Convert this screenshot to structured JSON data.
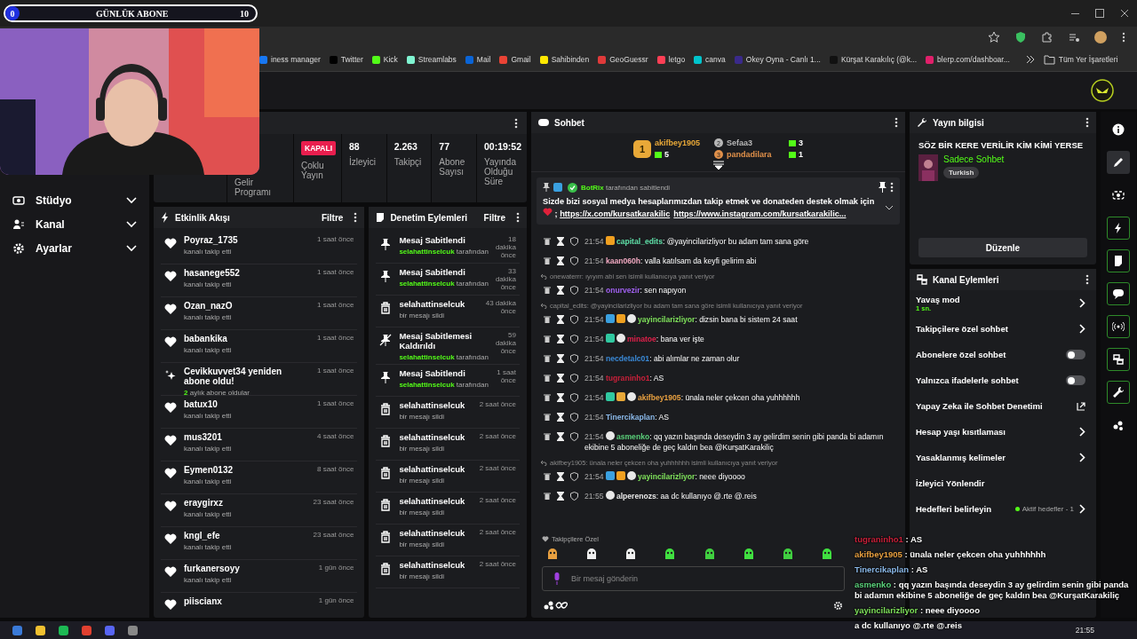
{
  "goal_overlay": {
    "current": "0",
    "label": "GÜNLÜK ABONE",
    "target": "10"
  },
  "bookmarks": [
    {
      "label": "iness manager",
      "color": "#1877f2"
    },
    {
      "label": "Twitter",
      "color": "#000000"
    },
    {
      "label": "Kick",
      "color": "#53fc18"
    },
    {
      "label": "Streamlabs",
      "color": "#80f5d2"
    },
    {
      "label": "Mail",
      "color": "#0a64d6"
    },
    {
      "label": "Gmail",
      "color": "#ea4335"
    },
    {
      "label": "Sahibinden",
      "color": "#ffe800"
    },
    {
      "label": "GeoGuessr",
      "color": "#e03a3a"
    },
    {
      "label": "letgo",
      "color": "#ff3f55"
    },
    {
      "label": "canva",
      "color": "#00c4cc"
    },
    {
      "label": "Okey Oyna - Canlı 1...",
      "color": "#3a2a8a"
    },
    {
      "label": "Kürşat Karakılıç (@k...",
      "color": "#111111"
    },
    {
      "label": "blerp.com/dashboar...",
      "color": "#e0206a"
    }
  ],
  "bookmarks_all": "Tüm Yer İşaretleri",
  "sidebar": {
    "items": [
      {
        "kind": "studio",
        "label": "Stüdyo"
      },
      {
        "kind": "channel",
        "label": "Kanal"
      },
      {
        "kind": "settings",
        "label": "Ayarlar"
      }
    ]
  },
  "stats": [
    {
      "label": "Gelir Programı"
    },
    {
      "badge": "KAPALI",
      "label": "Çoklu Yayın"
    },
    {
      "value": "88",
      "label": "İzleyici"
    },
    {
      "value": "2.263",
      "label": "Takipçi"
    },
    {
      "value": "77",
      "label": "Abone Sayısı"
    },
    {
      "value": "00:19:52",
      "label": "Yayında Olduğu Süre"
    }
  ],
  "activity": {
    "title": "Etkinlik Akışı",
    "filter": "Filtre",
    "items": [
      {
        "kind": "follow",
        "name": "Poyraz_1735",
        "detail": "kanalı takip etti",
        "time": "1 saat önce"
      },
      {
        "kind": "follow",
        "name": "hasanege552",
        "detail": "kanalı takip etti",
        "time": "1 saat önce"
      },
      {
        "kind": "follow",
        "name": "Ozan_nazO",
        "detail": "kanalı takip etti",
        "time": "1 saat önce"
      },
      {
        "kind": "follow",
        "name": "babankika",
        "detail": "kanalı takip etti",
        "time": "1 saat önce"
      },
      {
        "kind": "resub",
        "name": "Cevikkuvvet34 yeniden abone oldu!",
        "months": "2",
        "detail": "aylık abone oldular",
        "time": "1 saat önce"
      },
      {
        "kind": "follow",
        "name": "batux10",
        "detail": "kanalı takip etti",
        "time": "1 saat önce"
      },
      {
        "kind": "follow",
        "name": "mus3201",
        "detail": "kanalı takip etti",
        "time": "4 saat önce"
      },
      {
        "kind": "follow",
        "name": "Eymen0132",
        "detail": "kanalı takip etti",
        "time": "8 saat önce"
      },
      {
        "kind": "follow",
        "name": "eraygirxz",
        "detail": "kanalı takip etti",
        "time": "23 saat önce"
      },
      {
        "kind": "follow",
        "name": "kngl_efe",
        "detail": "kanalı takip etti",
        "time": "23 saat önce"
      },
      {
        "kind": "follow",
        "name": "furkanersoyy",
        "detail": "kanalı takip etti",
        "time": "1 gün önce"
      },
      {
        "kind": "follow",
        "name": "piiscianx",
        "time": "1 gün önce"
      }
    ]
  },
  "moderation": {
    "title": "Denetim Eylemleri",
    "filter": "Filtre",
    "items": [
      {
        "kind": "pin",
        "title": "Mesaj Sabitlendi",
        "user": "selahattinselcuk",
        "suffix": "tarafından",
        "time": "18 dakika önce"
      },
      {
        "kind": "pin",
        "title": "Mesaj Sabitlendi",
        "user": "selahattinselcuk",
        "suffix": "tarafından",
        "time": "33 dakika önce"
      },
      {
        "kind": "delete",
        "title": "selahattinselcuk",
        "detail": "bir mesajı sildi",
        "time": "43 dakika önce"
      },
      {
        "kind": "unpin",
        "title": "Mesaj Sabitlemesi Kaldırıldı",
        "user": "selahattinselcuk",
        "suffix": "tarafından",
        "time": "59 dakika önce"
      },
      {
        "kind": "pin",
        "title": "Mesaj Sabitlendi",
        "user": "selahattinselcuk",
        "suffix": "tarafından",
        "time": "1 saat önce"
      },
      {
        "kind": "delete",
        "title": "selahattinselcuk",
        "detail": "bir mesajı sildi",
        "time": "2 saat önce"
      },
      {
        "kind": "delete",
        "title": "selahattinselcuk",
        "detail": "bir mesajı sildi",
        "time": "2 saat önce"
      },
      {
        "kind": "delete",
        "title": "selahattinselcuk",
        "detail": "bir mesajı sildi",
        "time": "2 saat önce"
      },
      {
        "kind": "delete",
        "title": "selahattinselcuk",
        "detail": "bir mesajı sildi",
        "time": "2 saat önce"
      },
      {
        "kind": "delete",
        "title": "selahattinselcuk",
        "detail": "bir mesajı sildi",
        "time": "2 saat önce"
      },
      {
        "kind": "delete",
        "title": "selahattinselcuk",
        "detail": "bir mesajı sildi",
        "time": "2 saat önce"
      }
    ]
  },
  "chat": {
    "title": "Sohbet",
    "gifters": [
      {
        "rank": "1",
        "name": "akifbey1905",
        "count": "5",
        "color": "#e8a838"
      },
      {
        "rank": "2",
        "name": "Sefaa3",
        "count": "3",
        "color": "#b8b8b8"
      },
      {
        "rank": "3",
        "name": "pandadilara",
        "count": "1",
        "color": "#e0904a"
      }
    ],
    "pinned": {
      "by": "BotRix",
      "note": "tarafından sabitlendi",
      "text": "Sizde bizi sosyal medya hesaplarımızdan takip etmek ve donateden destek olmak için",
      "separator": ";",
      "links": [
        "https://x.com/kursatkarakilic",
        "https://www.instagram.com/kursatkarakilic..."
      ]
    },
    "messages": [
      {
        "kind": "message",
        "time": "21:54",
        "badges": [
          {
            "kind": "crown"
          }
        ],
        "user": "capital_edits",
        "color": "#5fe0a8",
        "text": ": @yayincilarizliyor bu adam tam sana göre"
      },
      {
        "kind": "message",
        "time": "21:54",
        "user": "kaan060h",
        "color": "#f0a8c0",
        "text": ": valla katılsam da keyfi gelirim abi"
      },
      {
        "kind": "reply",
        "text": "onewaterrr: ıyıyım abi sen isimli kullanıcıya yanıt veriyor"
      },
      {
        "kind": "message",
        "time": "21:54",
        "user": "onurvezir",
        "color": "#a060f0",
        "text": ": sen napıyon"
      },
      {
        "kind": "reply",
        "text": "capital_edits: @yayincilarizliyor bu adam tam sana göre isimli kullanıcıya yanıt veriyor"
      },
      {
        "kind": "message",
        "time": "21:54",
        "badges": [
          {
            "kind": "hammer"
          },
          {
            "kind": "crown"
          },
          {
            "kind": "panda"
          }
        ],
        "user": "yayincilarizliyor",
        "color": "#7ee05a",
        "text": ": dizsin bana bi sistem 24 saat"
      },
      {
        "kind": "message",
        "time": "21:54",
        "badges": [
          {
            "kind": "grid"
          },
          {
            "kind": "panda"
          }
        ],
        "user": "minatoe",
        "color": "#e0204a",
        "text": ": bana ver işte"
      },
      {
        "kind": "message",
        "time": "21:54",
        "user": "necdetalc01",
        "color": "#3a8ad8",
        "text": ": abi alımlar ne zaman olur"
      },
      {
        "kind": "message",
        "time": "21:54",
        "user": "tugraninho1",
        "color": "#c8203a",
        "text": ": AS"
      },
      {
        "kind": "message",
        "time": "21:54",
        "badges": [
          {
            "kind": "grid"
          },
          {
            "kind": "coin"
          },
          {
            "kind": "panda"
          }
        ],
        "user": "akifbey1905",
        "color": "#e8a040",
        "text": ": ünala neler çekcen oha yuhhhhhh"
      },
      {
        "kind": "message",
        "time": "21:54",
        "user": "Tinercikaplan",
        "color": "#8ab8e8",
        "text": ": AS"
      },
      {
        "kind": "message",
        "time": "21:54",
        "badges": [
          {
            "kind": "panda"
          }
        ],
        "user": "asmenko",
        "color": "#5ad07a",
        "text": ": qq yazın başında deseydin 3 ay gelirdim senin gibi panda bi adamın ekibine 5 aboneliğe de geç kaldın bea @KurşatKarakiliç"
      },
      {
        "kind": "reply",
        "text": "akifbey1905: ünala neler çekcen oha yuhhhhhh isimli kullanıcıya yanıt veriyor"
      },
      {
        "kind": "message",
        "time": "21:54",
        "badges": [
          {
            "kind": "hammer"
          },
          {
            "kind": "crown"
          },
          {
            "kind": "panda"
          }
        ],
        "user": "yayincilarizliyor",
        "color": "#7ee05a",
        "text": ": neee diyoooo"
      },
      {
        "kind": "message",
        "time": "21:55",
        "badges": [
          {
            "kind": "panda"
          }
        ],
        "user": "alperenozs",
        "color": "#e8e8e8",
        "text": ": aa dc kullanıyo @.rte @.reis"
      }
    ],
    "emotes_label": "Takipçilere Özel",
    "placeholder": "Bir mesaj gönderin"
  },
  "stream_info": {
    "title": "Yayın bilgisi",
    "stream_title": "SÖZ BİR KERE VERİLİR KİM KİMİ YERSE",
    "category": "Sadece Sohbet",
    "tag": "Turkish",
    "edit": "Düzenle"
  },
  "channel_actions": {
    "title": "Kanal Eylemleri",
    "items": [
      {
        "kind": "chevron",
        "label": "Yavaş mod",
        "sub": "1 sn."
      },
      {
        "kind": "chevron",
        "label": "Takipçilere özel sohbet"
      },
      {
        "kind": "toggle",
        "label": "Abonelere özel sohbet",
        "on": false
      },
      {
        "kind": "toggle",
        "label": "Yalnızca ifadelerle sohbet",
        "on": false
      },
      {
        "kind": "external",
        "label": "Yapay Zeka ile Sohbet Denetimi"
      },
      {
        "kind": "chevron",
        "label": "Hesap yaşı kısıtlaması"
      },
      {
        "kind": "chevron",
        "label": "Yasaklanmış kelimeler"
      },
      {
        "kind": "plain",
        "label": "İzleyici Yönlendir"
      },
      {
        "kind": "goal",
        "label": "Hedefleri belirleyin",
        "status": "Aktif hedefler - 1"
      }
    ]
  },
  "rail": [
    {
      "kind": "info",
      "on": false,
      "selected": false
    },
    {
      "kind": "pencil",
      "on": false,
      "selected": true
    },
    {
      "kind": "target",
      "on": false,
      "selected": false
    },
    {
      "kind": "bolt",
      "on": true,
      "selected": false
    },
    {
      "kind": "note",
      "on": true,
      "selected": false
    },
    {
      "kind": "chat",
      "on": true,
      "selected": false
    },
    {
      "kind": "broadcast",
      "on": true,
      "selected": false
    },
    {
      "kind": "video",
      "on": true,
      "selected": false
    },
    {
      "kind": "wrench",
      "on": true,
      "selected": false
    },
    {
      "kind": "dots",
      "on": false,
      "selected": false
    }
  ],
  "chat_overlay": [
    {
      "user": "tugraninho1",
      "color": "#c8203a",
      "text": " : AS"
    },
    {
      "user": "akifbey1905",
      "color": "#e8a040",
      "text": " : ünala neler çekcen oha yuhhhhhh"
    },
    {
      "user": "Tinercikaplan",
      "color": "#8ab8e8",
      "text": " : AS"
    },
    {
      "user": "asmenko",
      "color": "#5ad07a",
      "text": " : qq yazın başında deseydin 3 ay gelirdim senin gibi panda bi adamın ekibine 5 aboneliğe de geç kaldın bea @KurşatKarakiliç"
    },
    {
      "user": "yayincilarizliyor",
      "color": "#7ee05a",
      "text": " : neee diyoooo"
    }
  ],
  "overlay_tail": "a dc kullanıyo @.rte @.reis",
  "taskbar": {
    "time": "21:55"
  }
}
